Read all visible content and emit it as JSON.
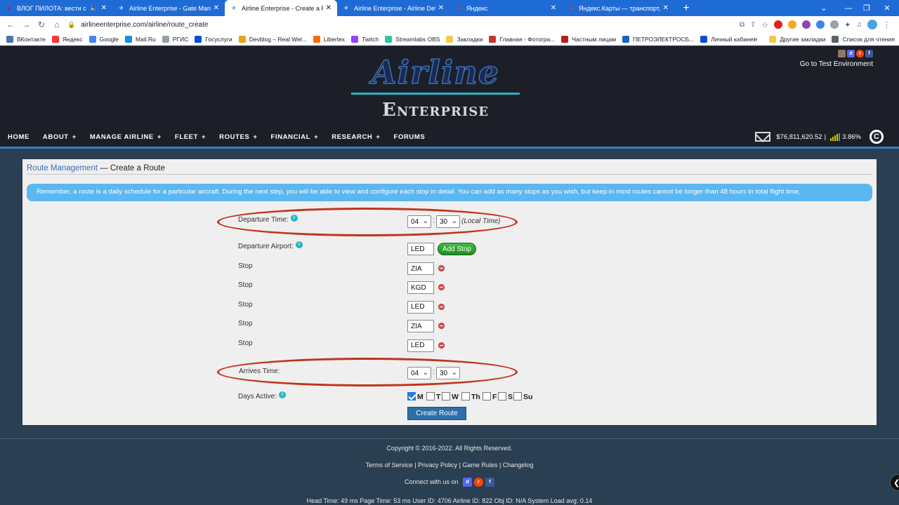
{
  "browser": {
    "tabs": [
      {
        "title": "ВЛОГ ПИЛОТА: вести с",
        "favicon": "youtube-icon",
        "color": "#ff0000",
        "audio": true
      },
      {
        "title": "Airline Enterprise - Gate Manage",
        "favicon": "plane-icon",
        "color": "#ffffff"
      },
      {
        "title": "Airline Enterprise - Create a Rout",
        "favicon": "plane-icon",
        "color": "#1f6bd6",
        "active": true
      },
      {
        "title": "Airline Enterprise - Airline Detail",
        "favicon": "plane-icon",
        "color": "#ffffff"
      },
      {
        "title": "Яндекс",
        "favicon": "yandex-icon",
        "color": "#ff3333"
      },
      {
        "title": "Яндекс.Карты — транспорт, нав",
        "favicon": "yandex-maps-icon",
        "color": "#ff3333"
      }
    ],
    "url": "airlineenterprise.com/airline/route_create",
    "bookmarks": [
      {
        "label": "ВКонтакте",
        "color": "#4a76a8"
      },
      {
        "label": "Яндекс",
        "color": "#ff3333"
      },
      {
        "label": "Google",
        "color": "#4285f4"
      },
      {
        "label": "Mail.Ru",
        "color": "#168de2"
      },
      {
        "label": "РГИС",
        "color": "#9aa0a6"
      },
      {
        "label": "Госуслуги",
        "color": "#0d4cd3"
      },
      {
        "label": "Devblog – Real Wel...",
        "color": "#e8a317"
      },
      {
        "label": "Libertex",
        "color": "#ff6a00"
      },
      {
        "label": "Twitch",
        "color": "#9146ff"
      },
      {
        "label": "Streamlabs OBS",
        "color": "#31c3a2"
      },
      {
        "label": "Закладки",
        "color": "#f2c94c"
      },
      {
        "label": "Главная - Фотогра...",
        "color": "#c0392b"
      },
      {
        "label": "Частным лицам",
        "color": "#b71c1c"
      },
      {
        "label": "ПЕТРОЭЛЕКТРОСБ...",
        "color": "#1565c0"
      },
      {
        "label": "Личный кабинет",
        "color": "#0d4cd3"
      }
    ],
    "bookmarks_more": "»",
    "bookmarks_right": [
      {
        "label": "Другие закладки",
        "color": "#f2c94c"
      },
      {
        "label": "Список для чтения",
        "color": "#5f6368"
      }
    ]
  },
  "header": {
    "logo_top": "Airline",
    "logo_bottom": "Enterprise",
    "test_env": "Go to Test Environment",
    "nav": [
      {
        "label": "HOME",
        "plus": ""
      },
      {
        "label": "ABOUT",
        "plus": "+"
      },
      {
        "label": "MANAGE AIRLINE",
        "plus": "+"
      },
      {
        "label": "FLEET",
        "plus": "+"
      },
      {
        "label": "ROUTES",
        "plus": "+"
      },
      {
        "label": "FINANCIAL",
        "plus": "+"
      },
      {
        "label": "RESEARCH",
        "plus": "+"
      },
      {
        "label": "FORUMS",
        "plus": ""
      }
    ],
    "balance": "$76,811,620.52",
    "separator": "|",
    "rate": "3.86%"
  },
  "page": {
    "breadcrumb_link": "Route Management",
    "breadcrumb_rest": " — Create a Route",
    "notice": "Remember, a route is a daily schedule for a particular aircraft. During the next step, you will be able to view and configure each stop in detail. You can add as many stops as you wish, but keep in mind routes cannot be longer than 48 hours in total flight time.",
    "departure_time_label": "Departure Time:",
    "departure_hour": "04",
    "departure_minute": "30",
    "time_colon": ":",
    "local_time": "(Local Time)",
    "departure_airport_label": "Departure Airport:",
    "departure_airport": "LED",
    "add_stop": "Add Stop",
    "stop_label": "Stop",
    "stops": [
      "ZIA",
      "KGD",
      "LED",
      "ZIA",
      "LED"
    ],
    "arrives_time_label": "Arrives Time:",
    "arrive_hour": "04",
    "arrive_minute": "30",
    "days_active_label": "Days Active:",
    "days": [
      {
        "label": "M",
        "checked": true
      },
      {
        "label": "T",
        "checked": false
      },
      {
        "label": "W",
        "checked": false
      },
      {
        "label": "Th",
        "checked": false
      },
      {
        "label": "F",
        "checked": false
      },
      {
        "label": "S",
        "checked": false
      },
      {
        "label": "Su",
        "checked": false
      }
    ],
    "create_route": "Create Route"
  },
  "footer": {
    "copyright": "Copyright © 2016-2022. All Rights Reserved.",
    "links": [
      "Terms of Service",
      "Privacy Policy",
      "Game Rules",
      "Changelog"
    ],
    "link_sep": " | ",
    "connect": "Connect with us on",
    "stats": "Head Time: 49 ms Page Time: 53 ms User ID: 4706 Airline ID: 822 Obj ID: N/A System Load avg: 0.14"
  },
  "colors": {
    "accent": "#2f80c9",
    "notice_bg": "#5cb7f0",
    "highlight_oval": "#c0351a",
    "add_stop_green": "#2aa52a"
  }
}
